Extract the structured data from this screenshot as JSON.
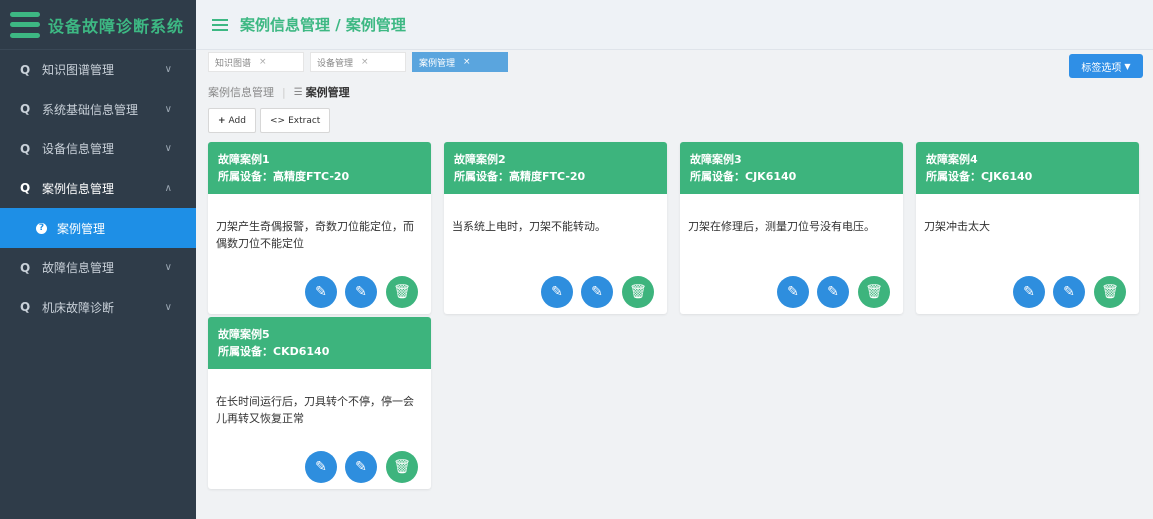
{
  "app": {
    "title": "设备故障诊断系统"
  },
  "header": {
    "breadcrumb": "案例信息管理 / 案例管理"
  },
  "sidebar": {
    "items": [
      {
        "label": "知识图谱管理",
        "icon": "search-icon",
        "chevron": "chevron-down-icon"
      },
      {
        "label": "系统基础信息管理",
        "icon": "search-icon",
        "chevron": "chevron-down-icon"
      },
      {
        "label": "设备信息管理",
        "icon": "search-icon",
        "chevron": "chevron-down-icon"
      },
      {
        "label": "案例信息管理",
        "icon": "search-icon",
        "chevron": "chevron-up-icon"
      },
      {
        "label": "故障信息管理",
        "icon": "search-icon",
        "chevron": "chevron-down-icon"
      },
      {
        "label": "机床故障诊断",
        "icon": "search-icon",
        "chevron": "chevron-down-icon"
      }
    ],
    "subitem": {
      "label": "案例管理"
    }
  },
  "tabs": [
    {
      "label": "知识图谱",
      "close": "×"
    },
    {
      "label": "设备管理",
      "close": "×"
    },
    {
      "label": "案例管理",
      "close": "×",
      "active": true
    }
  ],
  "tag_options": {
    "label": "标签选项"
  },
  "page_breadcrumb": {
    "parent": "案例信息管理",
    "current": "案例管理"
  },
  "toolbar": {
    "add_label": "Add",
    "extract_label": "Extract"
  },
  "cards": [
    {
      "title": "故障案例1",
      "device": "所属设备：高精度FTC-20",
      "desc": "刀架产生奇偶报警，奇数刀位能定位，而偶数刀位不能定位"
    },
    {
      "title": "故障案例2",
      "device": "所属设备：高精度FTC-20",
      "desc": "当系统上电时，刀架不能转动。"
    },
    {
      "title": "故障案例3",
      "device": "所属设备：CJK6140",
      "desc": "刀架在修理后，测量刀位号没有电压。"
    },
    {
      "title": "故障案例4",
      "device": "所属设备：CJK6140",
      "desc": "刀架冲击太大"
    },
    {
      "title": "故障案例5",
      "device": "所属设备：CKD6140",
      "desc": "在长时间运行后，刀具转个不停，停一会儿再转又恢复正常"
    }
  ],
  "colors": {
    "accent_green": "#3db47d",
    "accent_blue": "#2e8ede",
    "sidebar_bg": "#2f3c49"
  }
}
